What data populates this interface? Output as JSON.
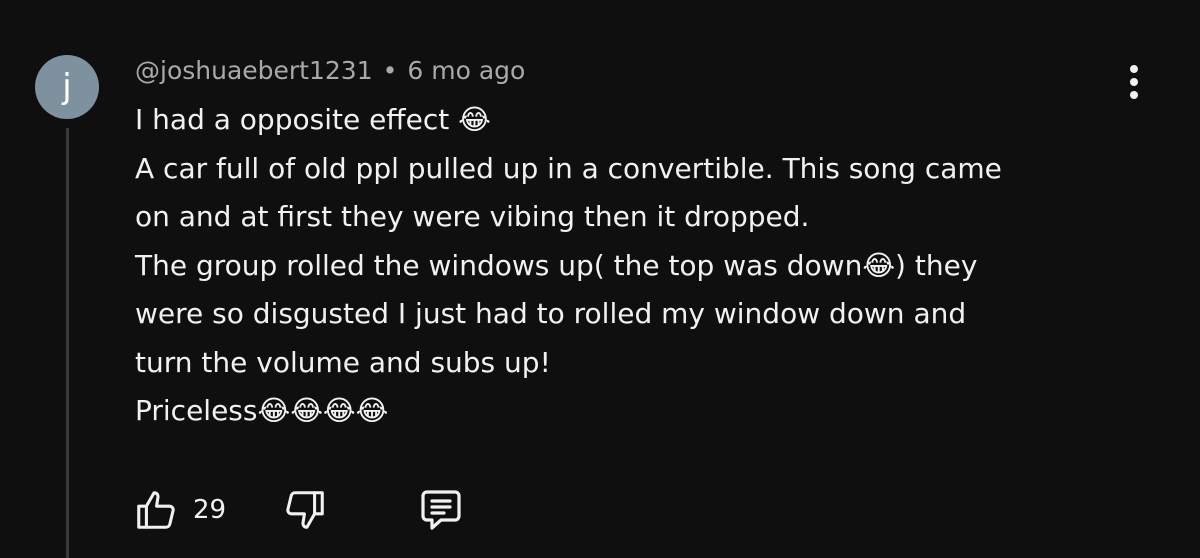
{
  "comment": {
    "avatar_letter": "j",
    "author": "@joshuaebert1231",
    "separator": "•",
    "timestamp": "6 mo ago",
    "lines": [
      "I had a opposite effect 😂",
      "A car full of old ppl pulled up in a convertible. This song came",
      "on and at first they were vibing then it dropped.",
      "The group rolled the windows up( the top was down😂) they",
      "were so disgusted I just had to rolled my window down and",
      "turn the volume and subs up!",
      "Priceless😂😂😂😂"
    ],
    "like_count": "29"
  },
  "icons": {
    "more": "more-vertical-icon",
    "like": "thumbs-up-icon",
    "dislike": "thumbs-down-icon",
    "reply": "comment-reply-icon"
  },
  "colors": {
    "background": "#0f0f0f",
    "text_primary": "#f1f1f1",
    "text_secondary": "#a9a9a9",
    "avatar": "#7d929e"
  }
}
